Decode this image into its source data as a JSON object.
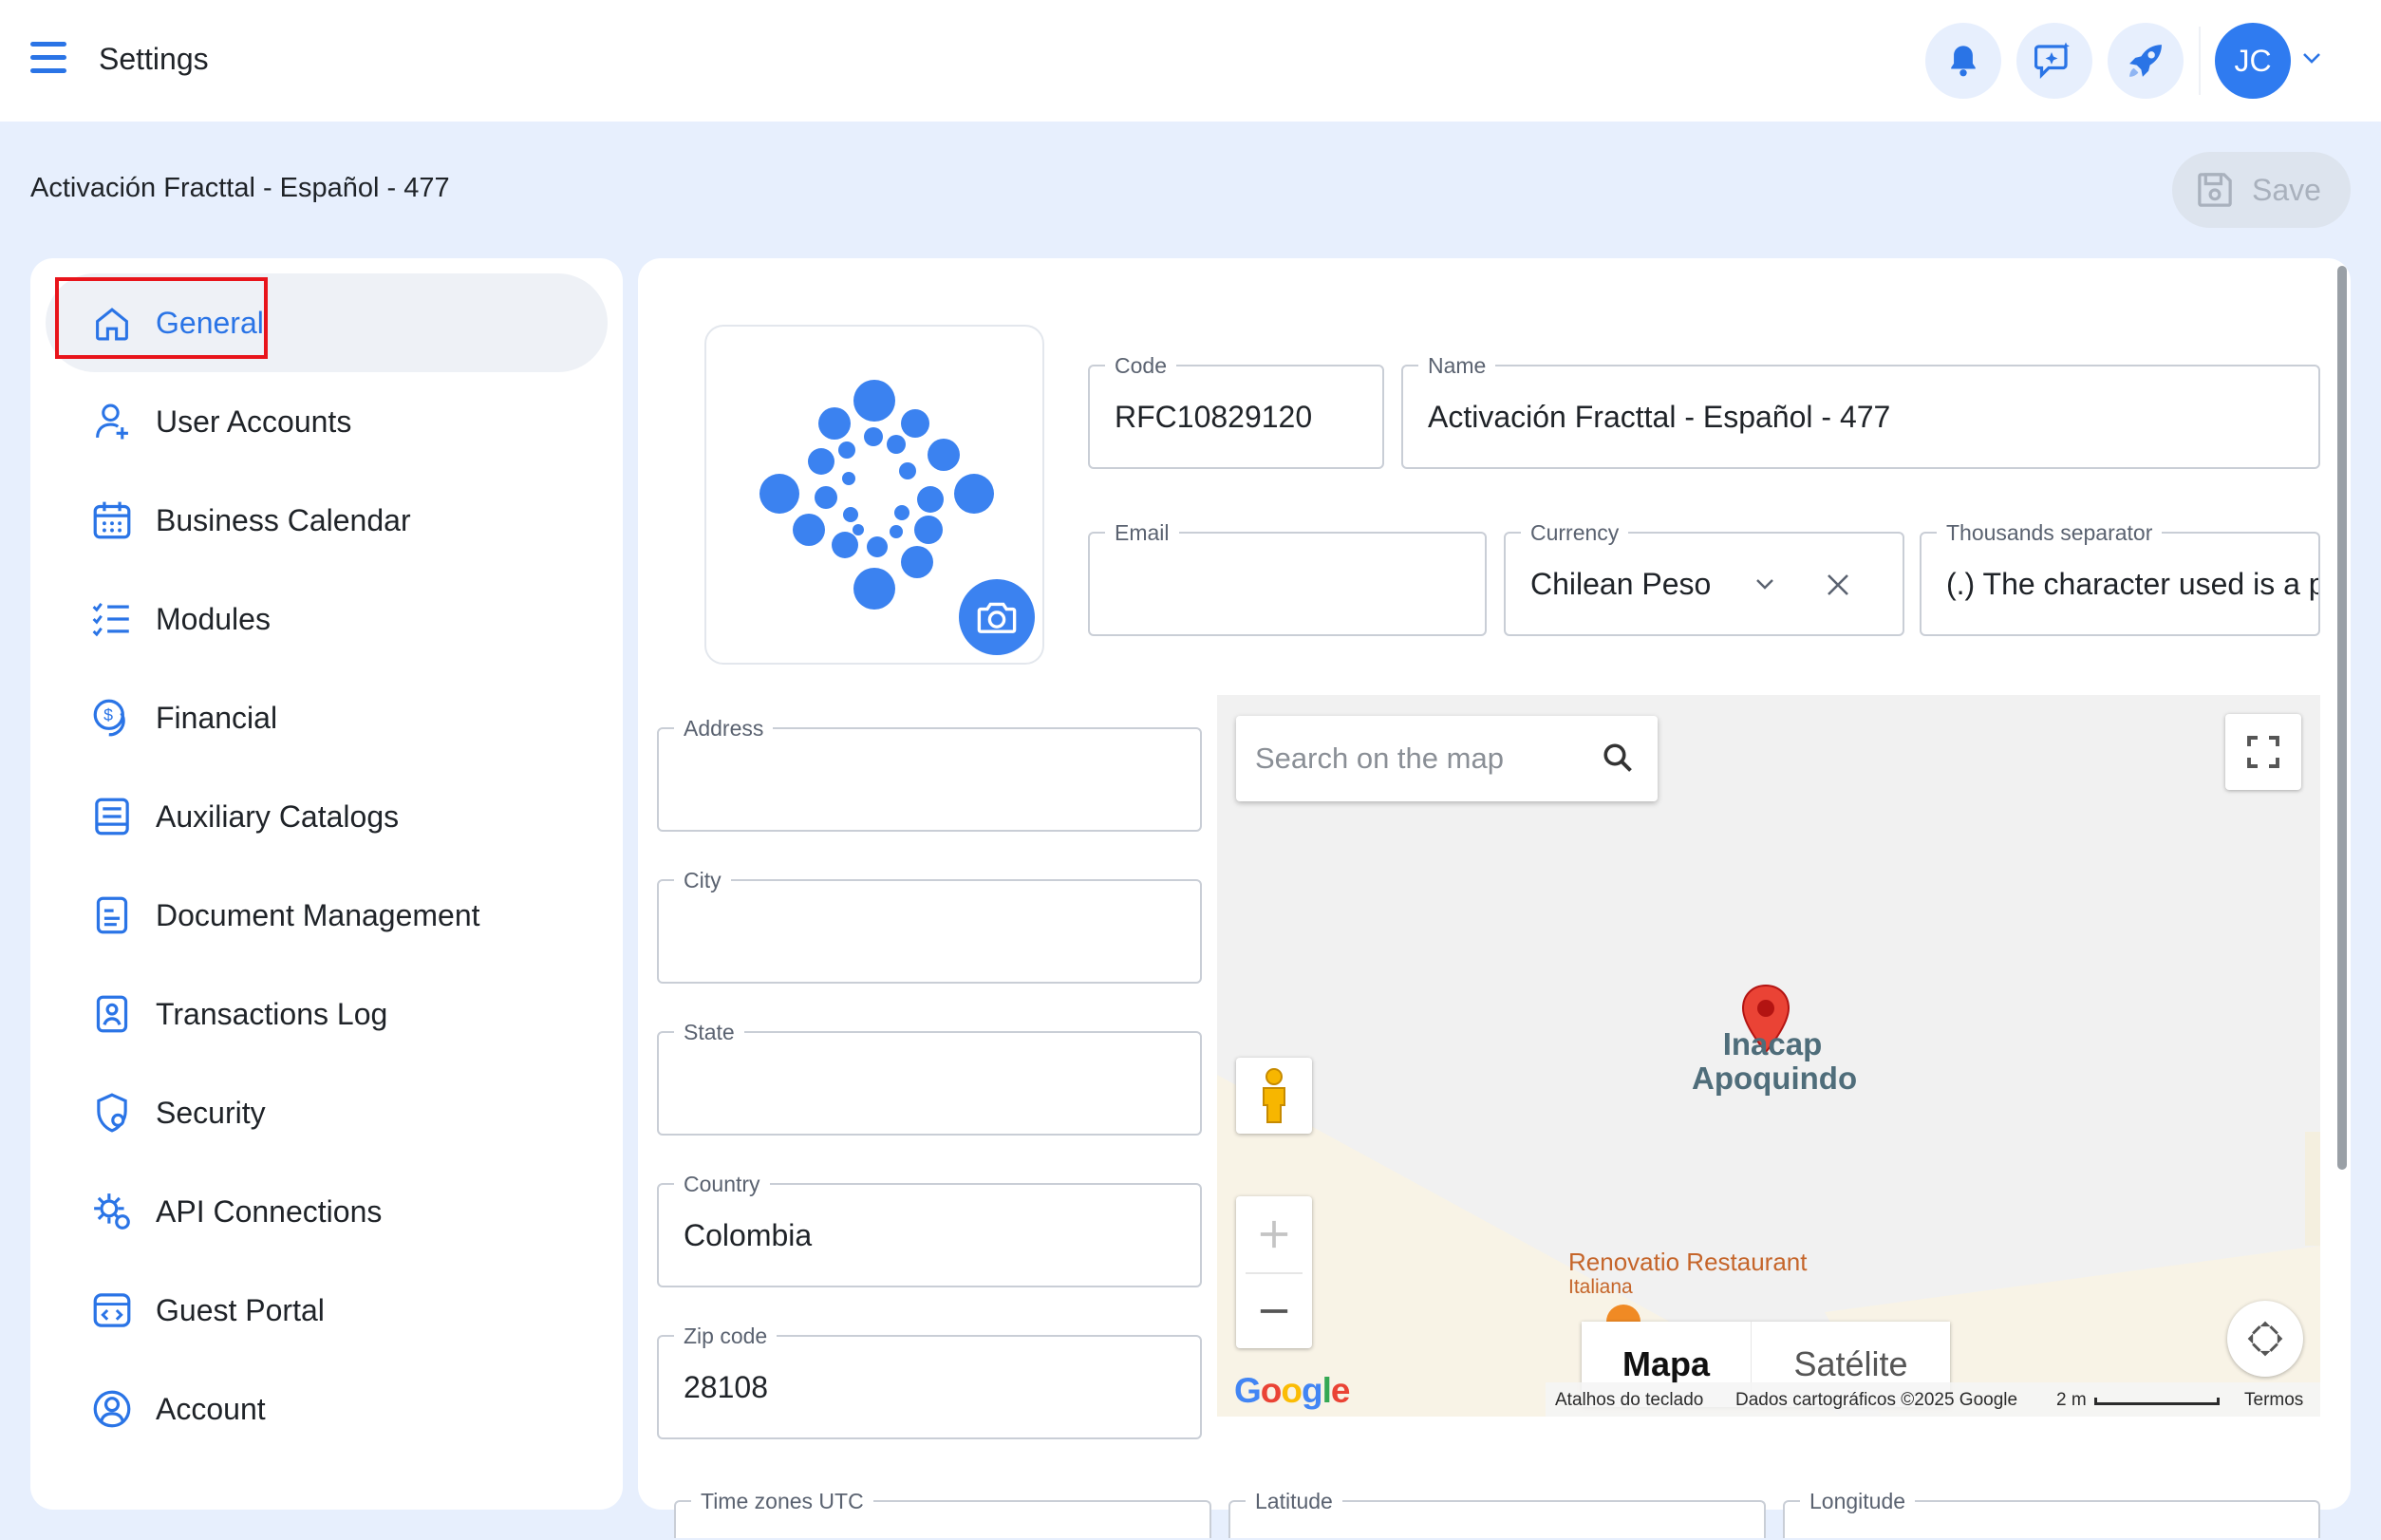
{
  "header": {
    "title": "Settings",
    "avatar_initials": "JC"
  },
  "company": {
    "title": "Activación Fracttal - Español - 477",
    "save_label": "Save"
  },
  "sidebar": {
    "items": [
      {
        "label": "General",
        "icon": "home-icon"
      },
      {
        "label": "User Accounts",
        "icon": "user-add-icon"
      },
      {
        "label": "Business Calendar",
        "icon": "calendar-icon"
      },
      {
        "label": "Modules",
        "icon": "checklist-icon"
      },
      {
        "label": "Financial",
        "icon": "coin-icon"
      },
      {
        "label": "Auxiliary Catalogs",
        "icon": "book-icon"
      },
      {
        "label": "Document Management",
        "icon": "document-icon"
      },
      {
        "label": "Transactions Log",
        "icon": "log-icon"
      },
      {
        "label": "Security",
        "icon": "shield-icon"
      },
      {
        "label": "API Connections",
        "icon": "api-gear-icon"
      },
      {
        "label": "Guest Portal",
        "icon": "portal-code-icon"
      },
      {
        "label": "Account",
        "icon": "account-circle-icon"
      }
    ]
  },
  "form": {
    "code": {
      "label": "Code",
      "value": "RFC10829120"
    },
    "name": {
      "label": "Name",
      "value": "Activación Fracttal - Español - 477"
    },
    "email": {
      "label": "Email",
      "value": ""
    },
    "currency": {
      "label": "Currency",
      "value": "Chilean Peso"
    },
    "thousands_separator": {
      "label": "Thousands separator",
      "value": "(.) The character used is a p"
    },
    "address": {
      "label": "Address",
      "value": ""
    },
    "city": {
      "label": "City",
      "value": ""
    },
    "state": {
      "label": "State",
      "value": ""
    },
    "country": {
      "label": "Country",
      "value": "Colombia"
    },
    "zip_code": {
      "label": "Zip code",
      "value": "28108"
    },
    "time_zones": {
      "label": "Time zones UTC"
    },
    "latitude": {
      "label": "Latitude"
    },
    "longitude": {
      "label": "Longitude"
    }
  },
  "map": {
    "search_placeholder": "Search on the map",
    "place_name_line1": "Inacap",
    "place_name_line2": "Apoquindo",
    "restaurant_name": "Renovatio Restaurant",
    "restaurant_type": "Italiana",
    "type_map": "Mapa",
    "type_satellite": "Satélite",
    "google_logo": "Google",
    "footer_shortcuts": "Atalhos do teclado",
    "footer_data": "Dados cartográficos ©2025 Google",
    "footer_scale": "2 m",
    "footer_terms": "Termos"
  },
  "colors": {
    "accent": "#2a74e6",
    "background": "#e7effd",
    "highlight": "#e8141b"
  }
}
